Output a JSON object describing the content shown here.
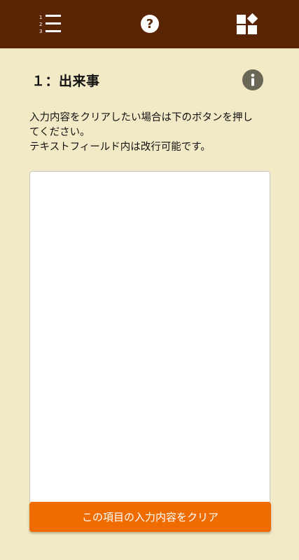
{
  "header": {
    "icons": [
      "numbered-list-icon",
      "help-icon",
      "widgets-icon"
    ]
  },
  "section": {
    "title": "１：出来事",
    "info_icon": "info-icon"
  },
  "instructions": {
    "line1": "入力内容をクリアしたい場合は下のボタンを押し",
    "line2": "てください。",
    "line3": "テキストフィールド内は改行可能です。"
  },
  "input": {
    "value": ""
  },
  "buttons": {
    "clear_label": "この項目の入力内容をクリア"
  },
  "colors": {
    "header_bg": "#5a2505",
    "page_bg": "#f2e9c6",
    "accent": "#ee6c00",
    "info_bg": "#6b6756"
  }
}
